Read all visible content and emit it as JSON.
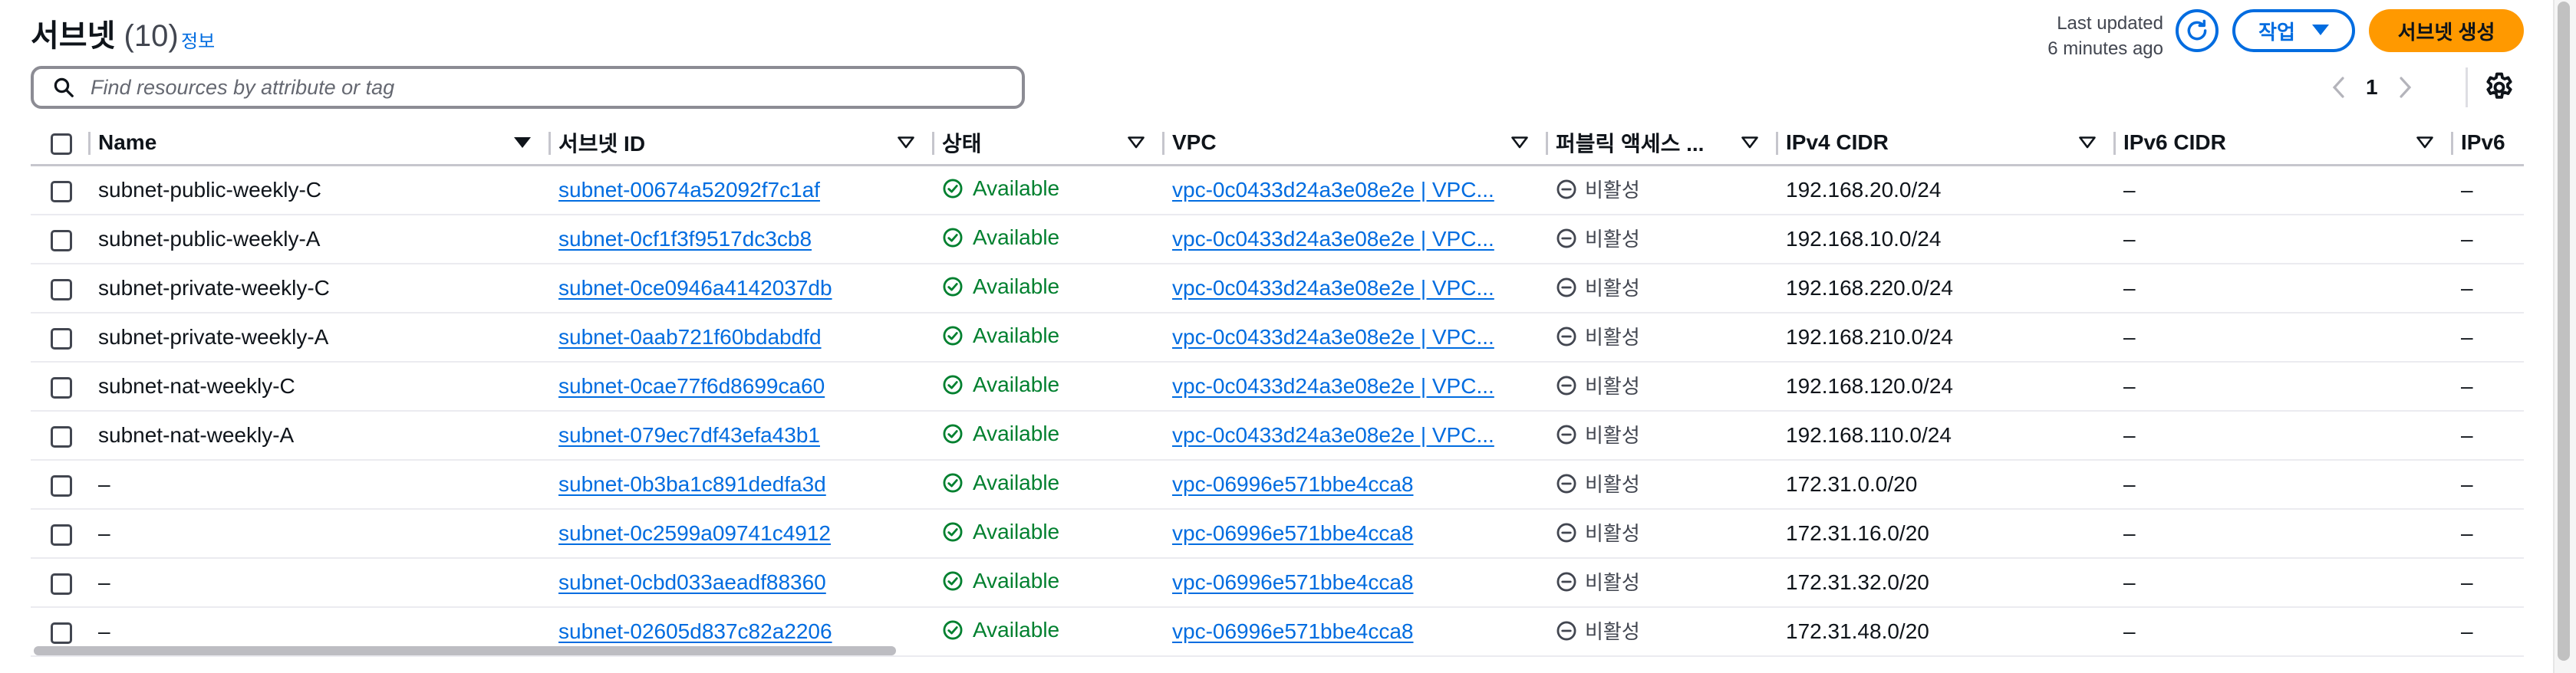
{
  "header": {
    "title": "서브넷",
    "count": "(10)",
    "info_link": "정보",
    "last_updated_line1": "Last updated",
    "last_updated_line2": "6 minutes ago",
    "action_button": "작업",
    "create_button": "서브넷 생성"
  },
  "search": {
    "placeholder": "Find resources by attribute or tag",
    "value": ""
  },
  "pagination": {
    "current_page": "1"
  },
  "table": {
    "columns": [
      "Name",
      "서브넷 ID",
      "상태",
      "VPC",
      "퍼블릭 액세스 ...",
      "IPv4 CIDR",
      "IPv6 CIDR",
      "IPv6"
    ],
    "rows": [
      {
        "name": "subnet-public-weekly-C",
        "subnet_id": "subnet-00674a52092f7c1af",
        "status": "Available",
        "vpc": "vpc-0c0433d24a3e08e2e | VPC...",
        "public_access": "비활성",
        "ipv4": "192.168.20.0/24",
        "ipv6": "–",
        "ipv6b": "–"
      },
      {
        "name": "subnet-public-weekly-A",
        "subnet_id": "subnet-0cf1f3f9517dc3cb8",
        "status": "Available",
        "vpc": "vpc-0c0433d24a3e08e2e | VPC...",
        "public_access": "비활성",
        "ipv4": "192.168.10.0/24",
        "ipv6": "–",
        "ipv6b": "–"
      },
      {
        "name": "subnet-private-weekly-C",
        "subnet_id": "subnet-0ce0946a4142037db",
        "status": "Available",
        "vpc": "vpc-0c0433d24a3e08e2e | VPC...",
        "public_access": "비활성",
        "ipv4": "192.168.220.0/24",
        "ipv6": "–",
        "ipv6b": "–"
      },
      {
        "name": "subnet-private-weekly-A",
        "subnet_id": "subnet-0aab721f60bdabdfd",
        "status": "Available",
        "vpc": "vpc-0c0433d24a3e08e2e | VPC...",
        "public_access": "비활성",
        "ipv4": "192.168.210.0/24",
        "ipv6": "–",
        "ipv6b": "–"
      },
      {
        "name": "subnet-nat-weekly-C",
        "subnet_id": "subnet-0cae77f6d8699ca60",
        "status": "Available",
        "vpc": "vpc-0c0433d24a3e08e2e | VPC...",
        "public_access": "비활성",
        "ipv4": "192.168.120.0/24",
        "ipv6": "–",
        "ipv6b": "–"
      },
      {
        "name": "subnet-nat-weekly-A",
        "subnet_id": "subnet-079ec7df43efa43b1",
        "status": "Available",
        "vpc": "vpc-0c0433d24a3e08e2e | VPC...",
        "public_access": "비활성",
        "ipv4": "192.168.110.0/24",
        "ipv6": "–",
        "ipv6b": "–"
      },
      {
        "name": "–",
        "subnet_id": "subnet-0b3ba1c891dedfa3d",
        "status": "Available",
        "vpc": "vpc-06996e571bbe4cca8",
        "public_access": "비활성",
        "ipv4": "172.31.0.0/20",
        "ipv6": "–",
        "ipv6b": "–"
      },
      {
        "name": "–",
        "subnet_id": "subnet-0c2599a09741c4912",
        "status": "Available",
        "vpc": "vpc-06996e571bbe4cca8",
        "public_access": "비활성",
        "ipv4": "172.31.16.0/20",
        "ipv6": "–",
        "ipv6b": "–"
      },
      {
        "name": "–",
        "subnet_id": "subnet-0cbd033aeadf88360",
        "status": "Available",
        "vpc": "vpc-06996e571bbe4cca8",
        "public_access": "비활성",
        "ipv4": "172.31.32.0/20",
        "ipv6": "–",
        "ipv6b": "–"
      },
      {
        "name": "–",
        "subnet_id": "subnet-02605d837c82a2206",
        "status": "Available",
        "vpc": "vpc-06996e571bbe4cca8",
        "public_access": "비활성",
        "ipv4": "172.31.48.0/20",
        "ipv6": "–",
        "ipv6b": "–"
      }
    ]
  },
  "colors": {
    "link": "#006ce0",
    "available": "#00802f",
    "primary_button": "#ff9900",
    "muted_text": "#424650"
  },
  "icons": {
    "search": "search-icon",
    "refresh": "refresh-icon",
    "dropdown": "caret-down-icon",
    "prev": "chevron-left-icon",
    "next": "chevron-right-icon",
    "settings": "gear-icon",
    "status_ok": "check-circle-icon",
    "inactive": "minus-circle-icon",
    "sort": "sort-caret-icon"
  }
}
